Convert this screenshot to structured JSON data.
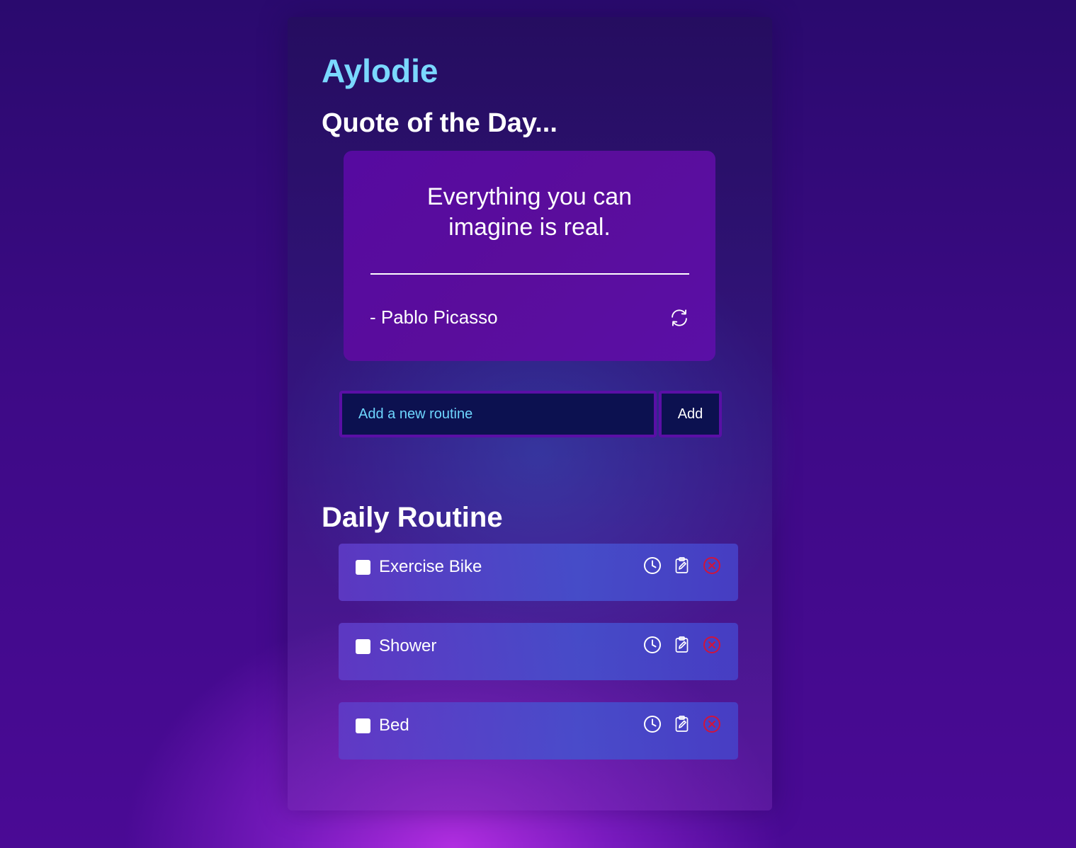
{
  "app": {
    "brand": "Aylodie"
  },
  "quote": {
    "heading": "Quote of the Day...",
    "text": "Everything you can imagine is real.",
    "author": "- Pablo Picasso",
    "refresh_icon": "refresh-icon"
  },
  "form": {
    "placeholder": "Add a new routine",
    "value": "",
    "add_label": "Add"
  },
  "routines": {
    "heading": "Daily Routine",
    "items": [
      {
        "label": "Exercise Bike",
        "checked": false
      },
      {
        "label": "Shower",
        "checked": false
      },
      {
        "label": "Bed",
        "checked": false
      }
    ],
    "action_icons": [
      "clock-icon",
      "edit-clipboard-icon",
      "delete-circle-x-icon"
    ]
  },
  "colors": {
    "brand": "#7ad8ff",
    "quote_card": "#560aa0",
    "input_bg": "#0c1150",
    "input_border": "#5a0fa6",
    "placeholder": "#6ed6ff",
    "delete": "#d0143c",
    "text": "#ffffff"
  }
}
